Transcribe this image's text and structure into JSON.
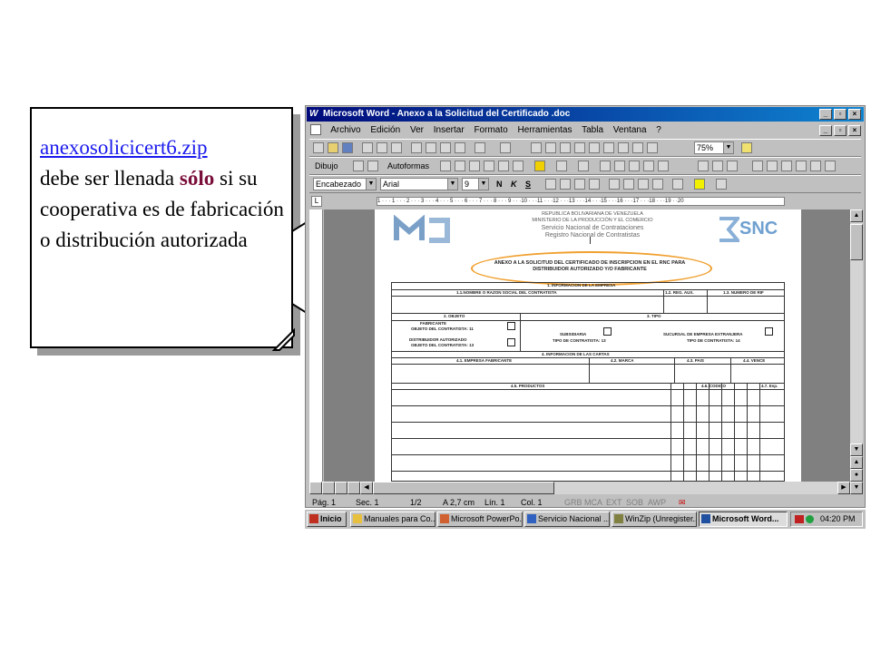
{
  "callout": {
    "link_text": "anexosolicicert6.zip",
    "line1": "debe ser llenada",
    "emph": "sólo",
    "rest": "si su cooperativa es de fabricación o distribución autorizada"
  },
  "window": {
    "title": "Microsoft Word - Anexo a la Solicitud del Certificado .doc",
    "app_icon": "W"
  },
  "menu": [
    "Archivo",
    "Edición",
    "Ver",
    "Insertar",
    "Formato",
    "Herramientas",
    "Tabla",
    "Ventana",
    "?"
  ],
  "toolbar": {
    "zoom": "75%",
    "dibujo": "Dibujo",
    "autoformas": "Autoformas",
    "style": "Encabezado",
    "font": "Arial",
    "size": "9",
    "bold": "N",
    "italic": "K",
    "underline": "S"
  },
  "ruler_text": "1 · · · 1 · · · 2 · · · 3 · · · 4 · · · 5 · · · 6 · · · 7 · · · 8 · · · 9 · · ·10 · · ·11 · · ·12 · · ·13 · · ·14 · · ·15 · · ·16 · · ·17 · · ·18 · · ·19 · ·20",
  "document": {
    "header_lines": [
      "REPUBLICA BOLIVARIANA DE VENEZUELA",
      "MINISTERIO DE LA PRODUCCIÓN Y EL COMERCIO",
      "Servicio Nacional de Contrataciones",
      "Registro Nacional de Contratistas"
    ],
    "snc_logo": "SNC",
    "annex_title": "ANEXO A LA SOLICITUD DEL CERTIFICADO DE INSCRIPCION EN EL RNC PARA",
    "annex_sub": "DISTRIBUIDOR AUTORIZADO Y/O FABRICANTE",
    "sec1": "1. INFORMACION DE LA EMPRESA",
    "col_name": "1.1.NOMBRE O RAZON SOCIAL DEL CONTRATISTA",
    "col_reg": "1.2. REG. AUX.",
    "col_rif": "1.3. NUMERO DE RIF",
    "sec2": "2. OBJETO",
    "sec3": "3. TIPO",
    "fabricante": "FABRICANTE",
    "obj11": "OBJETO DEL CONTRATISTA: 11",
    "distribuidor": "DISTRIBUIDOR AUTORIZADO",
    "obj13": "OBJETO DEL CONTRATISTA: 13",
    "subsidiaria": "SUBSIDIARIA",
    "tipo13": "TIPO DE CONTRATISTA: 13",
    "sucursal": "SUCURSAL DE EMPRESA EXTRANJERA",
    "tipo14": "TIPO DE CONTRATISTA: 14",
    "sec4": "4. INFORMACION DE LAS CARTAS",
    "c41": "4.1. EMPRESA FABRICANTE",
    "c42": "4.2. MARCA",
    "c43": "4.3. PAIS",
    "c44": "4.4. VENCE",
    "c45": "4.5. PRODUCTOS",
    "c46": "4.6. CODIGO",
    "c47": "4.7. Esp."
  },
  "status": {
    "page": "Pág. 1",
    "sec": "Sec. 1",
    "frac": "1/2",
    "pos": "A 2,7 cm",
    "line": "Lín. 1",
    "col": "Col. 1",
    "grb": "GRB",
    "mca": "MCA",
    "ext": "EXT",
    "sob": "SOB",
    "awp": "AWP"
  },
  "taskbar": {
    "start": "Inicio",
    "tasks": [
      "Manuales para Co...",
      "Microsoft PowerPo...",
      "Servicio Nacional ...",
      "WinZip (Unregister...",
      "Microsoft Word..."
    ],
    "clock": "04:20 PM"
  }
}
